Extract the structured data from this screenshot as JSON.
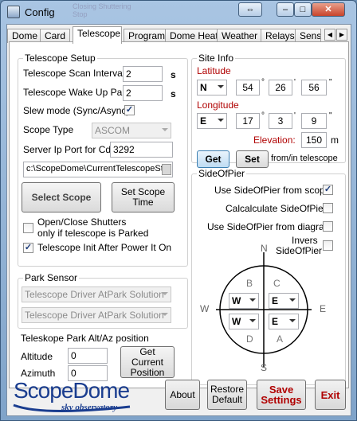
{
  "window": {
    "title": "Config",
    "ghost_lines": [
      "Closing Shuttering",
      "Stop"
    ]
  },
  "titlebar_buttons": {
    "swap": "⇔",
    "minimize": "–",
    "maximize": "□",
    "close": "✕"
  },
  "tabs": [
    "Dome",
    "Card",
    "Telescope",
    "Program",
    "Dome Heat",
    "Weather",
    "Relays",
    "Sensc"
  ],
  "tab_scroll": {
    "left": "◀",
    "right": "▶"
  },
  "telescope_setup": {
    "title": "Telescope Setup",
    "scan_interval_label": "Telescope Scan Interval",
    "scan_interval_value": "2",
    "scan_unit": "s",
    "wake_up_label": "Telescope Wake Up Pause",
    "wake_up_value": "2",
    "wake_unit": "s",
    "slew_label": "Slew mode (Sync/Async)",
    "slew_checked": "✓",
    "type_label": "Scope Type",
    "type_value": "ASCOM",
    "port_label": "Server Ip Port for CdC",
    "port_value": "3292",
    "path_value": "c:\\ScopeDome\\CurrentTelescopeSt",
    "select_scope_button": "Select Scope",
    "set_scope_time_button": "Set Scope Time",
    "open_close_label_1": "Open/Close Shutters",
    "open_close_label_2": "only if telescope is Parked",
    "init_label": "Telescope Init After Power It On",
    "init_checked": "✓"
  },
  "park_sensor": {
    "title": "Park Sensor",
    "combo1": "Telescope Driver AtPark Solution",
    "combo2": "Telescope Driver AtPark Solution"
  },
  "park_altaz": {
    "title": "Teleskope Park Alt/Az position",
    "altitude_label": "Altitude",
    "altitude_value": "0",
    "azimuth_label": "Azimuth",
    "azimuth_value": "0",
    "get_current_button": "Get Current Position"
  },
  "site_info": {
    "title": "Site Info",
    "latitude_label": "Latitude",
    "lat_hemi": "N",
    "lat_deg": "54",
    "lat_min": "26",
    "lat_sec": "56",
    "longitude_label": "Longitude",
    "lon_hemi": "E",
    "lon_deg": "17",
    "lon_min": "3",
    "lon_sec": "9",
    "deg_sym": "°",
    "min_sym": "'",
    "sec_sym": "\"",
    "elevation_label": "Elevation:",
    "elevation_value": "150",
    "elevation_unit": "m",
    "get_button": "Get",
    "set_button": "Set",
    "from_in_label": "from/in telescope"
  },
  "side_of_pier": {
    "title": "SideOfPier",
    "use_scope_label": "Use SideOfPier from scope",
    "use_scope_checked": "✓",
    "calculate_label": "Calcalculate SideOfPier",
    "diagram_label": "Use SideOfPier from diagram",
    "invers_label_1": "Invers",
    "invers_label_2": "SideOfPier",
    "compass": {
      "N": "N",
      "S": "S",
      "W": "W",
      "E": "E",
      "A": "A",
      "B": "B",
      "C": "C",
      "D": "D",
      "combos": [
        "W",
        "E",
        "W",
        "E"
      ]
    }
  },
  "footer": {
    "logo_main": "ScopeDome",
    "logo_sub": "sky observatory",
    "about_button": "About",
    "restore_button": "Restore Default",
    "save_button": "Save Settings",
    "exit_button": "Exit",
    "colors": {
      "logo_blue": "#1a3d8f",
      "logo_red": "#b00000"
    }
  }
}
